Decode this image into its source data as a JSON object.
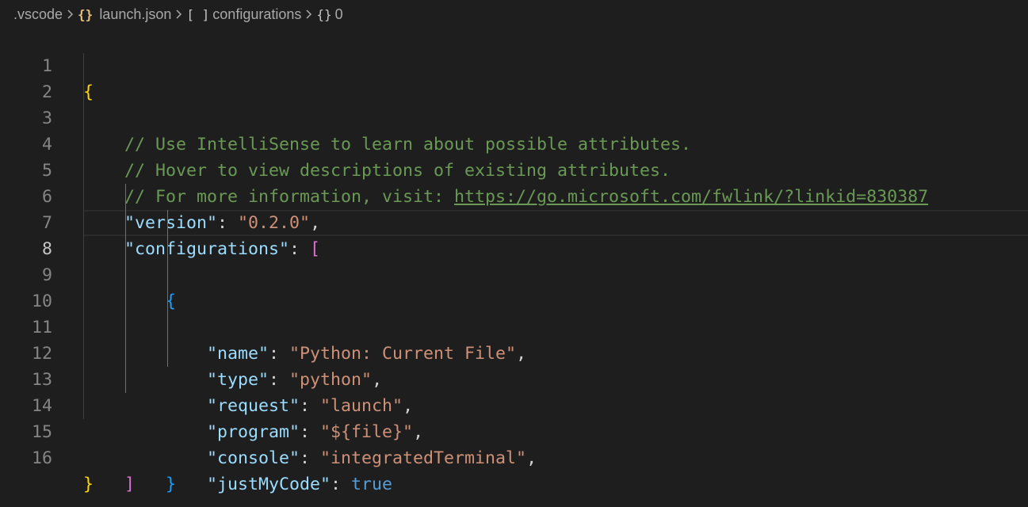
{
  "breadcrumb": {
    "folder": ".vscode",
    "file_icon": "{}",
    "file": "launch.json",
    "array_icon": "[ ]",
    "array": "configurations",
    "object_icon": "{}",
    "object": "0"
  },
  "editor": {
    "current_line": 8,
    "lines": [
      {
        "num": "1"
      },
      {
        "num": "2"
      },
      {
        "num": "3"
      },
      {
        "num": "4"
      },
      {
        "num": "5"
      },
      {
        "num": "6"
      },
      {
        "num": "7"
      },
      {
        "num": "8"
      },
      {
        "num": "9"
      },
      {
        "num": "10"
      },
      {
        "num": "11"
      },
      {
        "num": "12"
      },
      {
        "num": "13"
      },
      {
        "num": "14"
      },
      {
        "num": "15"
      },
      {
        "num": "16"
      }
    ],
    "code": {
      "open_brace": "{",
      "close_brace": "}",
      "comment1": "// Use IntelliSense to learn about possible attributes.",
      "comment2": "// Hover to view descriptions of existing attributes.",
      "comment3_prefix": "// For more information, visit: ",
      "comment3_link": "https://go.microsoft.com/fwlink/?linkid=830387",
      "version_key": "\"version\"",
      "version_value": "\"0.2.0\"",
      "configurations_key": "\"configurations\"",
      "open_bracket": "[",
      "close_bracket": "]",
      "obj_open": "{",
      "obj_close": "}",
      "colon": ": ",
      "comma": ",",
      "name_key": "\"name\"",
      "name_value": "\"Python: Current File\"",
      "type_key": "\"type\"",
      "type_value": "\"python\"",
      "request_key": "\"request\"",
      "request_value": "\"launch\"",
      "program_key": "\"program\"",
      "program_value": "\"${file}\"",
      "console_key": "\"console\"",
      "console_value": "\"integratedTerminal\"",
      "justmycode_key": "\"justMyCode\"",
      "justmycode_value": "true"
    }
  },
  "colors": {
    "background": "#1e1e1e",
    "comment": "#6a9955",
    "key": "#9cdcfe",
    "string": "#ce9178",
    "boolean": "#569cd6",
    "bracket_level1": "#ffd700",
    "bracket_level2": "#da70d6",
    "bracket_level3": "#179fff"
  }
}
